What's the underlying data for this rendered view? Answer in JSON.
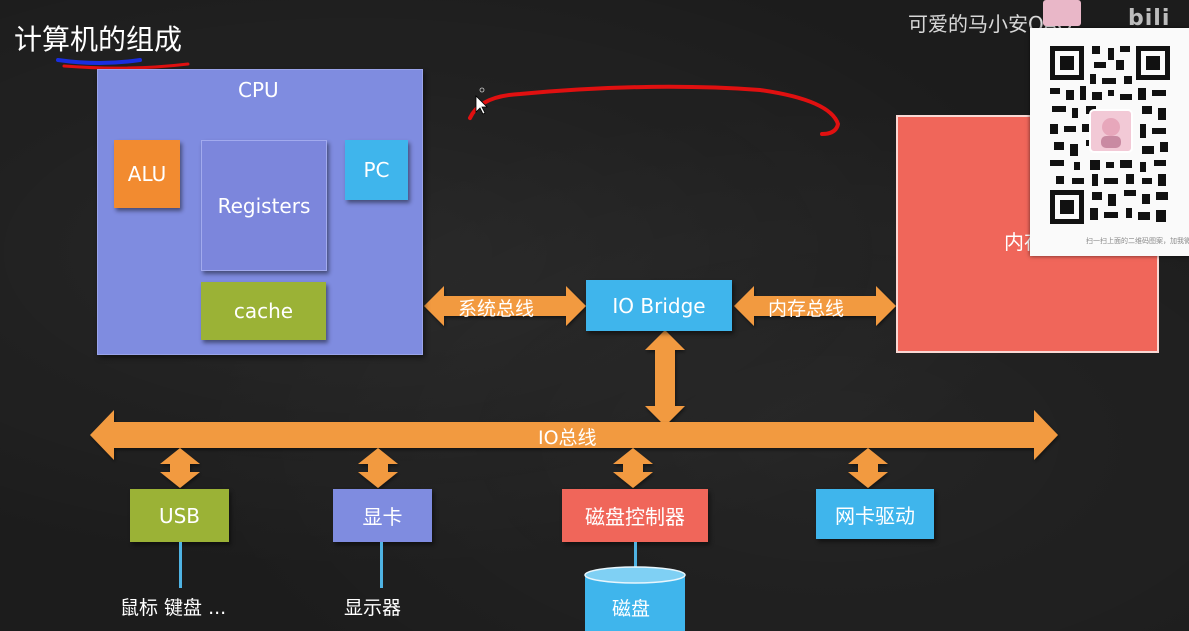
{
  "title": "计算机的组成",
  "cpu": {
    "label": "CPU"
  },
  "components": {
    "alu": "ALU",
    "registers": "Registers",
    "pc": "PC",
    "cache": "cache",
    "io_bridge": "IO Bridge",
    "memory": "内存",
    "usb": "USB",
    "gpu": "显卡",
    "disk_controller": "磁盘控制器",
    "nic_driver": "网卡驱动",
    "disk": "磁盘"
  },
  "buses": {
    "system_bus": "系统总线",
    "memory_bus": "内存总线",
    "io_bus": "IO总线"
  },
  "devices": {
    "usb_devices": "鼠标 键盘 ...",
    "display": "显示器"
  },
  "overlay": {
    "watermark": "可爱的马小安OAO",
    "site_logo": "bili",
    "qr_caption": "扫一扫上面的二维码图案，加我微信"
  },
  "colors": {
    "cpu": "#7f8ce0",
    "alu": "#f28b30",
    "registers": "#7c86dc",
    "pc": "#3fb5ec",
    "cache": "#9bb236",
    "io_bridge": "#3fb5ec",
    "memory": "#f0665a",
    "bus": "#f29a40",
    "usb": "#9bb236",
    "gpu": "#7f8ce0",
    "disk_controller": "#f0665a",
    "nic_driver": "#3fb5ec",
    "disk": "#3fb5ec",
    "annotation": "#e01010"
  }
}
